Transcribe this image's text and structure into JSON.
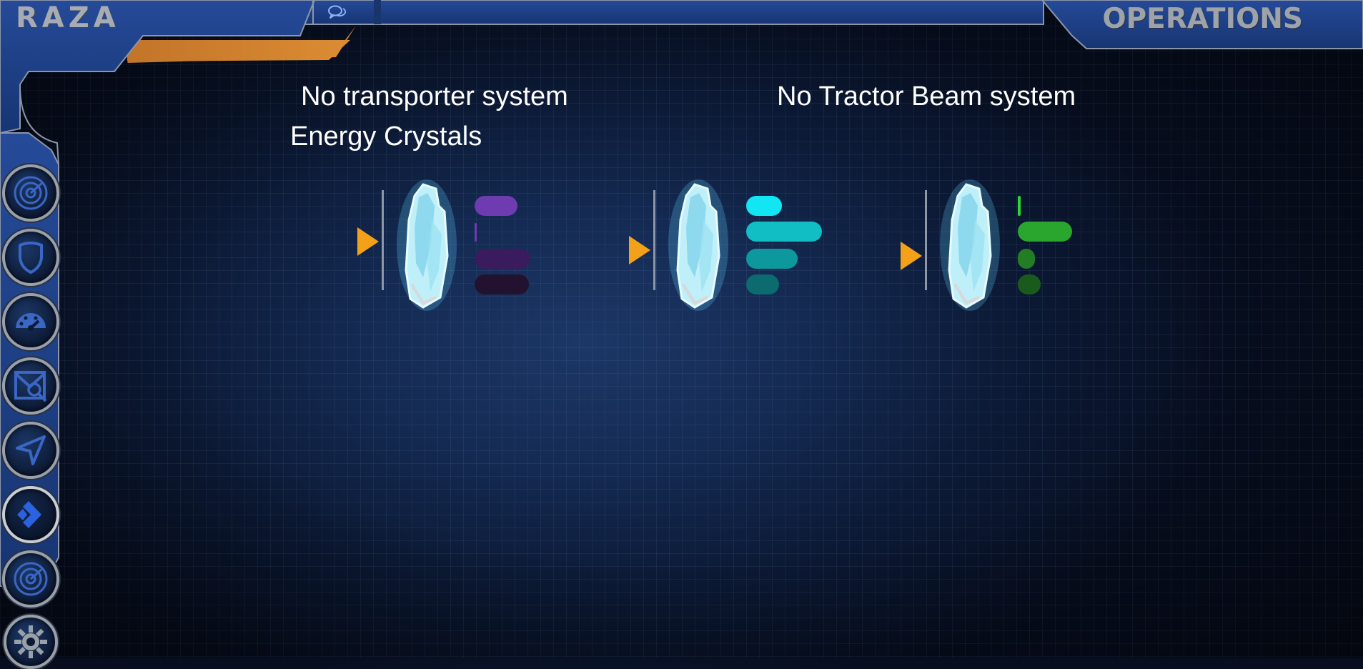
{
  "header": {
    "brand": "RAZA",
    "section_title": "OPERATIONS",
    "chat_icon": "chat-bubbles-icon"
  },
  "nav": {
    "items": [
      {
        "icon": "radar-icon"
      },
      {
        "icon": "shield-icon"
      },
      {
        "icon": "speedometer-icon"
      },
      {
        "icon": "scan-map-icon"
      },
      {
        "icon": "navigation-arrow-icon"
      },
      {
        "icon": "chevron-right-icon",
        "active": true
      },
      {
        "icon": "radar-icon"
      },
      {
        "icon": "gear-icon"
      }
    ]
  },
  "main": {
    "transporter_status": "No transporter system",
    "tractor_status": "No Tractor Beam system",
    "resource_heading": "Energy Crystals",
    "crystal_groups": [
      {
        "name_icon": "energy-crystal-icon",
        "bar_color_scheme": "purple",
        "bars": [
          {
            "color": "#6e3bb0",
            "level": 0.6
          },
          {
            "color": "#6e3bb0",
            "level": 0.02
          },
          {
            "color": "#3a1c5e",
            "level": 0.78
          },
          {
            "color": "#22112f",
            "level": 0.78
          }
        ]
      },
      {
        "name_icon": "energy-crystal-icon",
        "bar_color_scheme": "cyan",
        "bars": [
          {
            "color": "#12e6f2",
            "level": 0.5
          },
          {
            "color": "#10bec4",
            "level": 1.08
          },
          {
            "color": "#0c989c",
            "level": 0.72
          },
          {
            "color": "#0b6b6e",
            "level": 0.45
          }
        ]
      },
      {
        "name_icon": "energy-crystal-icon",
        "bar_color_scheme": "green",
        "bars": [
          {
            "color": "#2fd63a",
            "level": 0.02
          },
          {
            "color": "#2aa52e",
            "level": 0.76
          },
          {
            "color": "#227d25",
            "level": 0.24
          },
          {
            "color": "#1b5a1d",
            "level": 0.32
          }
        ]
      }
    ]
  },
  "colors": {
    "accent_orange": "#f4a11a",
    "frame_blue": "#1e3f86",
    "frame_edge": "#8c96a8",
    "background": "#0c1a36"
  }
}
